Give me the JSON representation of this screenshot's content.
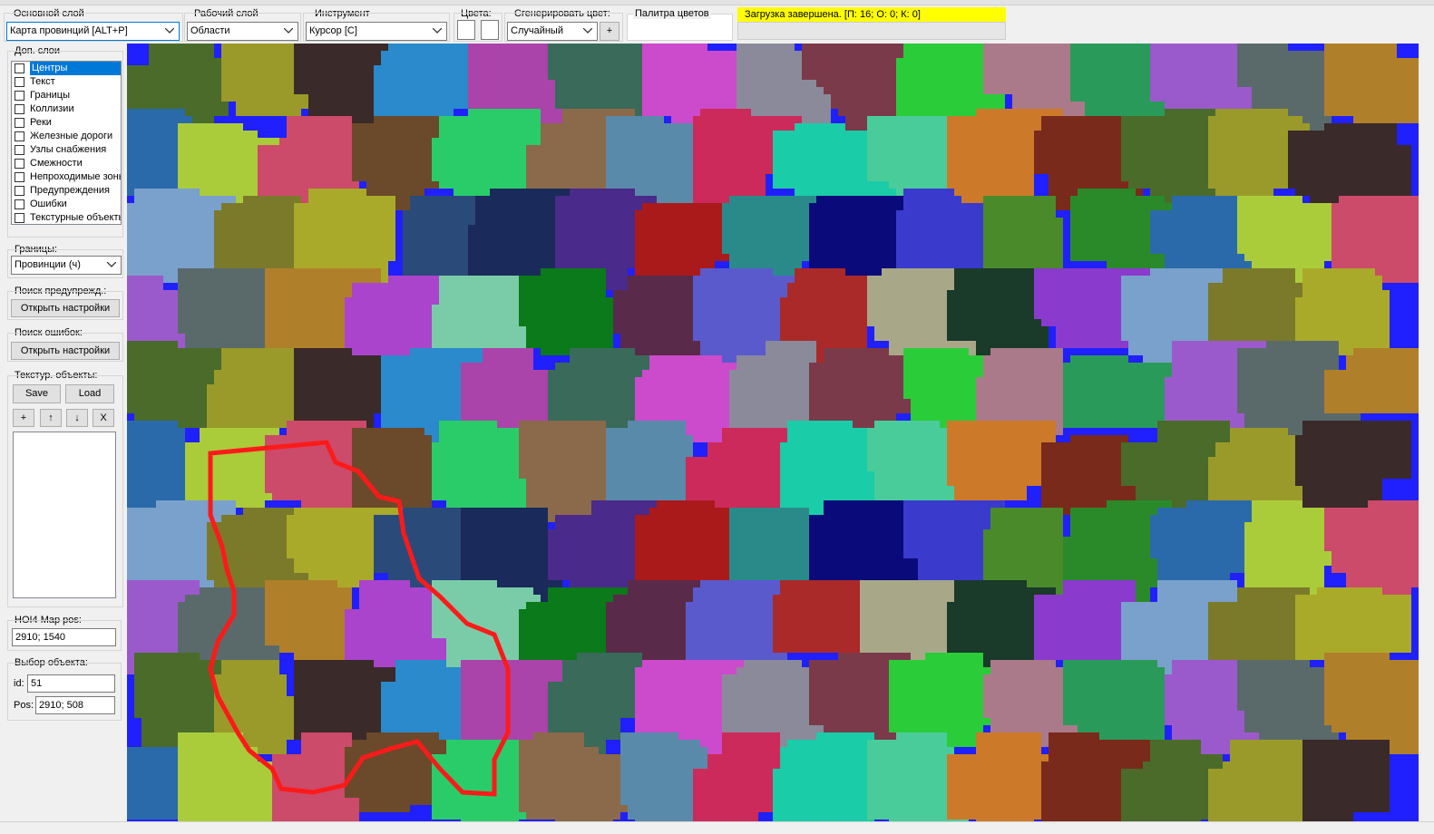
{
  "toolbar": {
    "main_layer": {
      "label": "Основной слой",
      "value": "Карта провинций [ALT+P]"
    },
    "work_layer": {
      "label": "Рабочий слой",
      "value": "Области"
    },
    "tool": {
      "label": "Инструмент",
      "value": "Курсор [C]"
    },
    "colors": {
      "label": "Цвета:"
    },
    "generate_color": {
      "label": "Сгенерировать цвет:",
      "value": "Случайный",
      "add_button": "+"
    },
    "palette": {
      "label": "Палитра цветов"
    },
    "status": "Загрузка завершена. [П: 16; О: 0; К: 0]"
  },
  "sidebar": {
    "extra_layers": {
      "label": "Доп. слои",
      "items": [
        {
          "label": "Центры",
          "checked": false,
          "selected": true
        },
        {
          "label": "Текст",
          "checked": false
        },
        {
          "label": "Границы",
          "checked": false
        },
        {
          "label": "Коллизии",
          "checked": false
        },
        {
          "label": "Реки",
          "checked": false
        },
        {
          "label": "Железные дороги",
          "checked": false
        },
        {
          "label": "Узлы снабжения",
          "checked": false
        },
        {
          "label": "Смежности",
          "checked": false
        },
        {
          "label": "Непроходимые зоны",
          "checked": false
        },
        {
          "label": "Предупреждения",
          "checked": false
        },
        {
          "label": "Ошибки",
          "checked": false
        },
        {
          "label": "Текстурные объекты",
          "checked": false
        }
      ]
    },
    "borders": {
      "label": "Границы:",
      "value": "Провинции (ч)"
    },
    "warnings_search": {
      "label": "Поиск предупрежд.:",
      "button": "Открыть настройки"
    },
    "errors_search": {
      "label": "Поиск ошибок:",
      "button": "Открыть настройки"
    },
    "texture_objects": {
      "label": "Текстур. объекты:",
      "save": "Save",
      "load": "Load",
      "add": "+",
      "up": "↑",
      "down": "↓",
      "remove": "X"
    },
    "map_pos": {
      "label": "HOI4 Map pos:",
      "value": "2910; 1540"
    },
    "object_select": {
      "label": "Выбор объекта:",
      "id_label": "id:",
      "id_value": "51",
      "pos_label": "Pos:",
      "pos_value": "2910; 508"
    }
  },
  "colors": {
    "selection_outline": "#ff1a1a",
    "status_bg": "#ffff00",
    "list_selected": "#0078d7"
  }
}
